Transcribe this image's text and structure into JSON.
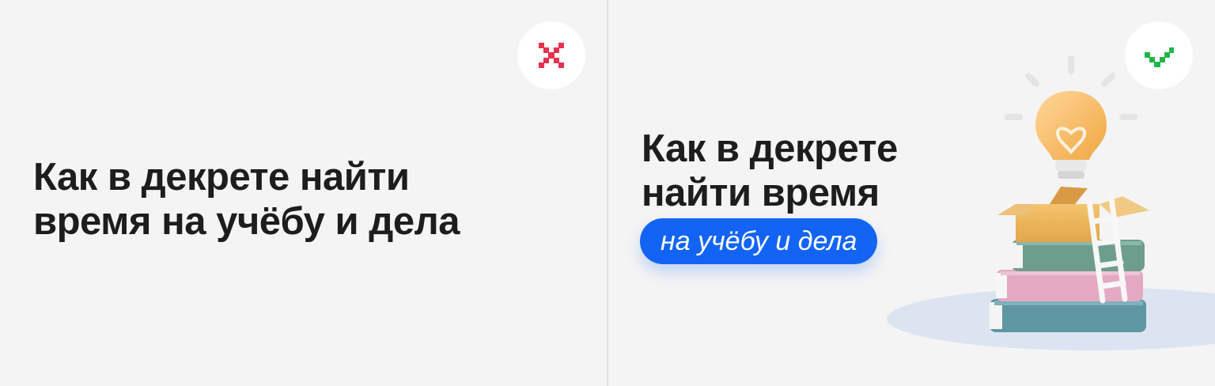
{
  "comparison": {
    "bad": {
      "verdict": "incorrect",
      "icon": "cross-icon",
      "icon_color": "#e8314f",
      "title": "Как в декрете найти\nвремя на учёбу и дела"
    },
    "good": {
      "verdict": "correct",
      "icon": "check-icon",
      "icon_color": "#21b54a",
      "title": "Как в декрете\nнайти время",
      "highlight": "на учёбу и дела",
      "highlight_color": "#1364f5",
      "illustration": "books-lightbulb-illustration"
    }
  }
}
